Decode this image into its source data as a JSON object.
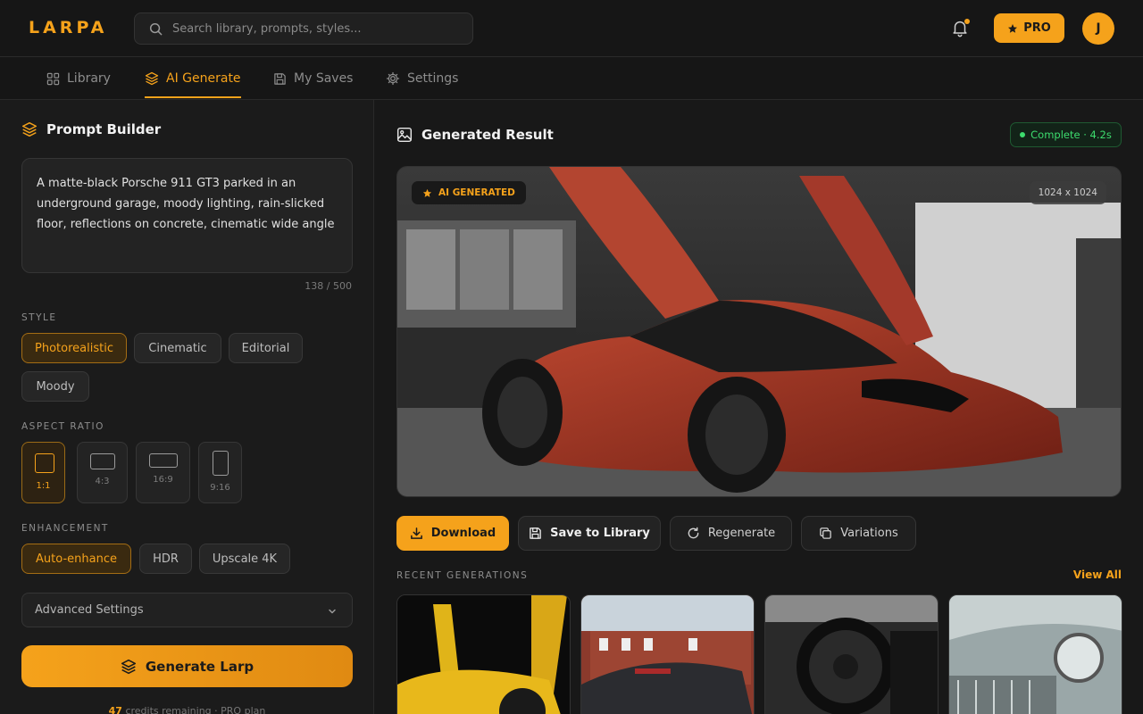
{
  "app": {
    "logo": "LARPA"
  },
  "search": {
    "placeholder": "Search library, prompts, styles..."
  },
  "header": {
    "pro_label": "PRO",
    "avatar_initial": "J"
  },
  "nav": {
    "tabs": [
      {
        "label": "Library",
        "icon": "grid-icon"
      },
      {
        "label": "AI Generate",
        "icon": "layers-icon",
        "active": true
      },
      {
        "label": "My Saves",
        "icon": "save-icon"
      },
      {
        "label": "Settings",
        "icon": "gear-icon"
      }
    ]
  },
  "builder": {
    "title": "Prompt Builder",
    "prompt": "A matte-black Porsche 911 GT3 parked in an underground garage, moody lighting, rain-slicked floor, reflections on concrete, cinematic wide angle",
    "counter": "138 / 500",
    "style_label": "STYLE",
    "styles": [
      "Photorealistic",
      "Cinematic",
      "Editorial",
      "Moody"
    ],
    "aspect_label": "ASPECT RATIO",
    "ratios": [
      "1:1",
      "4:3",
      "16:9",
      "9:16"
    ],
    "enhancement_label": "ENHANCEMENT",
    "enhancements": [
      "Auto-enhance",
      "HDR",
      "Upscale 4K"
    ],
    "advanced_label": "Advanced Settings",
    "generate_label": "Generate Larp",
    "credits_count": "47",
    "credits_text": " credits remaining · PRO plan"
  },
  "result": {
    "title": "Generated Result",
    "status": "Complete · 4.2s",
    "badge": "AI GENERATED",
    "size": "1024 x 1024",
    "actions": [
      "Download",
      "Save to Library",
      "Regenerate",
      "Variations"
    ]
  },
  "recent": {
    "label": "RECENT GENERATIONS",
    "view_all": "View All"
  },
  "colors": {
    "accent": "#f5a21b",
    "success": "#3ddc6e",
    "background": "#181818"
  }
}
